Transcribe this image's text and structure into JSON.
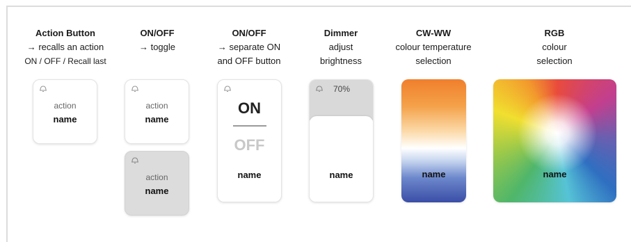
{
  "columns": [
    {
      "title": "Action Button",
      "lines": [
        "→ recalls an action",
        "ON / OFF / Recall last"
      ]
    },
    {
      "title": "ON/OFF",
      "lines": [
        "→ toggle"
      ]
    },
    {
      "title": "ON/OFF",
      "lines": [
        "→ separate ON",
        "and OFF button"
      ]
    },
    {
      "title": "Dimmer",
      "lines": [
        "adjust",
        "brightness"
      ]
    },
    {
      "title": "CW-WW",
      "lines": [
        "colour temperature",
        "selection"
      ]
    },
    {
      "title": "RGB",
      "lines": [
        "colour",
        "selection"
      ]
    }
  ],
  "tiles": {
    "action": {
      "line1": "action",
      "name": "name"
    },
    "toggle_off": {
      "line1": "action",
      "name": "name"
    },
    "toggle_on": {
      "line1": "action",
      "name": "name"
    },
    "onoff": {
      "on": "ON",
      "off": "OFF",
      "name": "name"
    },
    "dimmer": {
      "percent": "70%",
      "level": 0.7,
      "name": "name"
    },
    "cwww": {
      "name": "name"
    },
    "rgb": {
      "name": "name"
    }
  },
  "icons": {
    "bell": "bell-icon"
  },
  "colors": {
    "grey_tile": "#dcdcdc",
    "cw_warm": "#f07f2c",
    "cw_cool": "#3a4ea6"
  }
}
